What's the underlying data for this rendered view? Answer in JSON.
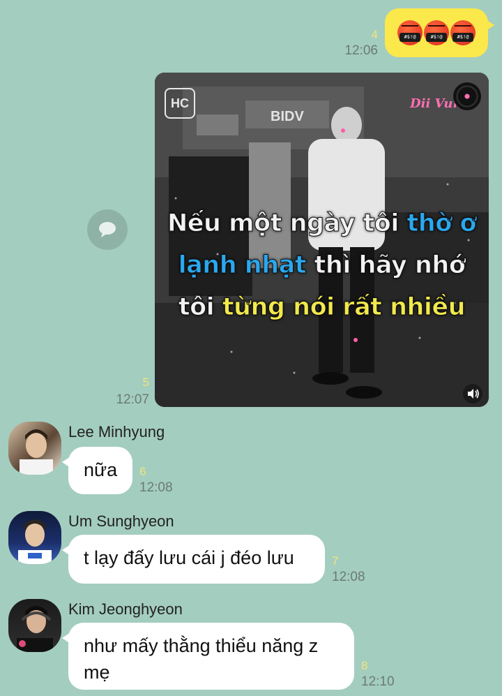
{
  "messages": {
    "m1": {
      "unread": "4",
      "time": "12:06",
      "emoji_label": "#$!@"
    },
    "m2": {
      "unread": "5",
      "time": "12:07",
      "video": {
        "logo": "HC",
        "sign": "BIDV",
        "watermark": "Dii Vun",
        "lyric_line1": [
          "Nếu một ngày tôi ",
          "thờ ơ"
        ],
        "lyric_line2": [
          "lạnh nhạt",
          " thì hãy nhớ"
        ],
        "lyric_line3": [
          "tôi ",
          "từng nói rất nhiều"
        ]
      }
    },
    "m3": {
      "sender": "Lee Minhyung",
      "text": "nữa",
      "unread": "6",
      "time": "12:08"
    },
    "m4": {
      "sender": "Um Sunghyeon",
      "text": "t lạy đấy lưu cái j đéo lưu",
      "unread": "7",
      "time": "12:08"
    },
    "m5": {
      "sender": "Kim Jeonghyeon",
      "text": "như mấy thằng thiểu năng z mẹ",
      "unread": "8",
      "time": "12:10"
    }
  },
  "icons": {
    "share": "speech-bubble-icon",
    "volume": "speaker-icon"
  },
  "colors": {
    "background": "#a3cdbf",
    "outgoing_bubble": "#fbe84a",
    "incoming_bubble": "#ffffff",
    "unread": "#f3e47a"
  }
}
